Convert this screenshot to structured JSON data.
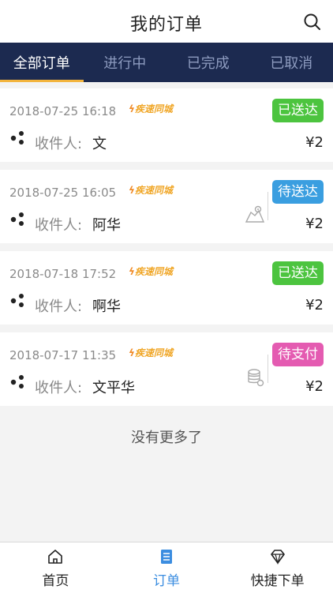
{
  "header": {
    "title": "我的订单",
    "search_icon": "search-icon"
  },
  "tabs": [
    {
      "label": "全部订单",
      "active": true
    },
    {
      "label": "进行中",
      "active": false
    },
    {
      "label": "已完成",
      "active": false
    },
    {
      "label": "已取消",
      "active": false
    }
  ],
  "orders": [
    {
      "datetime": "2018-07-25 16:18",
      "brand": "疾速同城",
      "recipient_label": "收件人:",
      "recipient": "文",
      "status": "已送达",
      "status_color": "#4cc43f",
      "price": "¥2",
      "side_icon": ""
    },
    {
      "datetime": "2018-07-25 16:05",
      "brand": "疾速同城",
      "recipient_label": "收件人:",
      "recipient": "阿华",
      "status": "待送达",
      "status_color": "#3a9ee0",
      "price": "¥2",
      "side_icon": "map-location-icon"
    },
    {
      "datetime": "2018-07-18 17:52",
      "brand": "疾速同城",
      "recipient_label": "收件人:",
      "recipient": "啊华",
      "status": "已送达",
      "status_color": "#4cc43f",
      "price": "¥2",
      "side_icon": ""
    },
    {
      "datetime": "2018-07-17 11:35",
      "brand": "疾速同城",
      "recipient_label": "收件人:",
      "recipient": "文平华",
      "status": "待支付",
      "status_color": "#e45bb1",
      "price": "¥2",
      "side_icon": "coin-stack-icon"
    }
  ],
  "footer_note": "没有更多了",
  "bottom_nav": [
    {
      "label": "首页",
      "icon": "home-icon",
      "active": false
    },
    {
      "label": "订单",
      "icon": "order-list-icon",
      "active": true
    },
    {
      "label": "快捷下单",
      "icon": "diamond-icon",
      "active": false
    }
  ],
  "colors": {
    "nav_bar": "#1c2a50",
    "tab_underline": "#f3b43d",
    "active_nav": "#3b8de0"
  }
}
